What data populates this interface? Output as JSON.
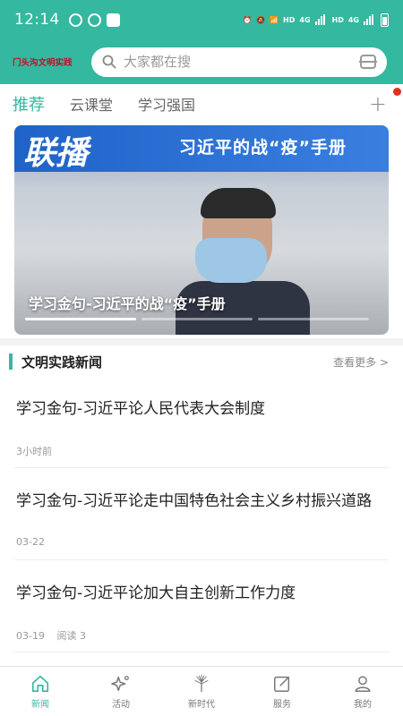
{
  "status_bar": {
    "time": "12:14",
    "network_labels": [
      "HD",
      "4G",
      "HD",
      "4G"
    ]
  },
  "header": {
    "logo_text": "门头沟文明实践",
    "search_placeholder": "大家都在搜"
  },
  "tabs": [
    {
      "label": "推荐",
      "active": true
    },
    {
      "label": "云课堂",
      "active": false
    },
    {
      "label": "学习强国",
      "active": false
    }
  ],
  "tab_add_icon": "plus-icon",
  "banner": {
    "logo_text": "联播",
    "top_title": "习近平的战“疫”手册",
    "caption": "学习金句-习近平的战“疫”手册",
    "slide_count": 3,
    "active_slide": 1
  },
  "section": {
    "title": "文明实践新闻",
    "more_label": "查看更多 >"
  },
  "news": [
    {
      "title": "学习金句-习近平论人民代表大会制度",
      "time": "3小时前",
      "reads": ""
    },
    {
      "title": "学习金句-习近平论走中国特色社会主义乡村振兴道路",
      "time": "03-22",
      "reads": ""
    },
    {
      "title": "学习金句-习近平论加大自主创新工作力度",
      "time": "03-19",
      "reads": "阅读 3"
    }
  ],
  "bottom_nav": [
    {
      "label": "新闻",
      "icon": "home-icon",
      "active": true
    },
    {
      "label": "活动",
      "icon": "sparkle-icon",
      "active": false
    },
    {
      "label": "新时代",
      "icon": "tree-icon",
      "active": false
    },
    {
      "label": "服务",
      "icon": "edit-icon",
      "active": false
    },
    {
      "label": "我的",
      "icon": "user-icon",
      "active": false
    }
  ],
  "colors": {
    "accent": "#34b8a0",
    "dot": "#e0301e"
  }
}
